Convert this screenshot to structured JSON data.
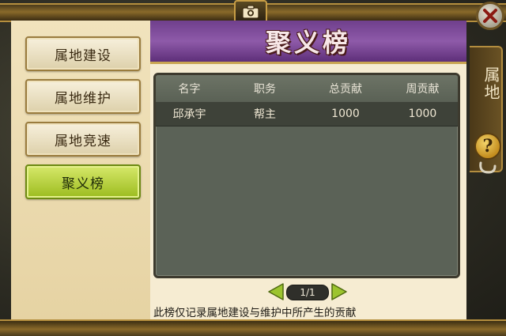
{
  "title": "聚义榜",
  "nav": {
    "items": [
      {
        "label": "属地建设",
        "active": false
      },
      {
        "label": "属地维护",
        "active": false
      },
      {
        "label": "属地竞速",
        "active": false
      },
      {
        "label": "聚义榜",
        "active": true
      }
    ]
  },
  "table": {
    "headers": [
      "名字",
      "职务",
      "总贡献",
      "周贡献"
    ],
    "rows": [
      [
        "邱承宇",
        "帮主",
        "1000",
        "1000"
      ]
    ]
  },
  "pager": {
    "label": "1/1"
  },
  "footer_note": "此榜仅记录属地建设与维护中所产生的贡献",
  "side_tab": {
    "label": "属地"
  },
  "help": {
    "symbol": "?"
  },
  "icons": {
    "camera": "camera-icon",
    "close": "close-icon",
    "prev": "arrow-left-icon",
    "next": "arrow-right-icon",
    "help": "question-icon"
  },
  "colors": {
    "banner": "#7b4a9a",
    "active_nav": "#a9c82c",
    "table_bg": "#5b6257",
    "arrow": "#8fb82a"
  }
}
